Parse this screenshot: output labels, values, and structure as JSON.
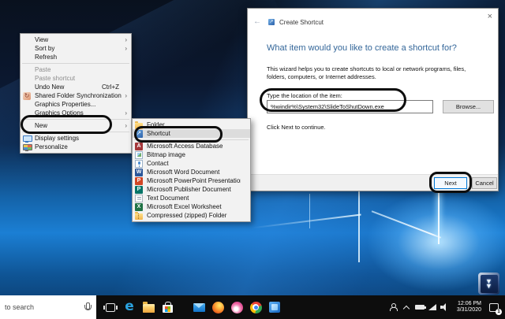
{
  "glyphs": {
    "submenu_arrow": "›",
    "back_arrow": "←",
    "close": "×",
    "desktop_arrow": "▼"
  },
  "context_menu": {
    "items": [
      {
        "label": "View",
        "submenu": true
      },
      {
        "label": "Sort by",
        "submenu": true
      },
      {
        "label": "Refresh"
      },
      {
        "separator": true
      },
      {
        "label": "Paste",
        "disabled": true
      },
      {
        "label": "Paste shortcut",
        "disabled": true
      },
      {
        "label": "Undo New",
        "accel": "Ctrl+Z"
      },
      {
        "label": "Shared Folder Synchronization",
        "icon": "sync",
        "submenu": true
      },
      {
        "label": "Graphics Properties..."
      },
      {
        "label": "Graphics Options",
        "submenu": true
      },
      {
        "separator": true
      },
      {
        "label": "New",
        "submenu": true
      },
      {
        "separator": true
      },
      {
        "label": "Display settings",
        "icon": "display"
      },
      {
        "label": "Personalize",
        "icon": "personalize"
      }
    ]
  },
  "new_submenu": {
    "items": [
      {
        "label": "Folder",
        "icon": "folder"
      },
      {
        "label": "Shortcut",
        "icon": "shortcut",
        "highlighted": true
      },
      {
        "separator": true
      },
      {
        "label": "Microsoft Access Database",
        "icon": "access"
      },
      {
        "label": "Bitmap image",
        "icon": "bitmap"
      },
      {
        "label": "Contact",
        "icon": "contact"
      },
      {
        "label": "Microsoft Word Document",
        "icon": "word"
      },
      {
        "label": "Microsoft PowerPoint Presentation",
        "icon": "powerpoint"
      },
      {
        "label": "Microsoft Publisher Document",
        "icon": "publisher"
      },
      {
        "label": "Text Document",
        "icon": "text"
      },
      {
        "label": "Microsoft Excel Worksheet",
        "icon": "excel"
      },
      {
        "label": "Compressed (zipped) Folder",
        "icon": "zip"
      }
    ]
  },
  "wizard": {
    "title": "Create Shortcut",
    "heading": "What item would you like to create a shortcut for?",
    "description": "This wizard helps you to create shortcuts to local or network programs, files, folders, computers, or Internet addresses.",
    "location_label": "Type the location of the item:",
    "location_value": "%windir%\\System32\\SlideToShutDown.exe",
    "browse_label": "Browse...",
    "hint": "Click Next to continue.",
    "next_label": "Next",
    "cancel_label": "Cancel"
  },
  "taskbar": {
    "search": {
      "text": "to search"
    },
    "app_icons": [
      {
        "name": "task-view"
      },
      {
        "name": "edge"
      },
      {
        "name": "file-explorer"
      },
      {
        "name": "microsoft-store"
      },
      {
        "name": "spacer"
      },
      {
        "name": "mail"
      },
      {
        "name": "firefox"
      },
      {
        "name": "paint-3d"
      },
      {
        "name": "chrome"
      },
      {
        "name": "photos"
      }
    ],
    "tray": {
      "time": "12:06 PM",
      "date": "3/31/2020",
      "notification_badge": "1"
    }
  },
  "colors": {
    "accent": "#0078d7",
    "heading_blue": "#336699",
    "taskbar": "#0d0d0d"
  }
}
